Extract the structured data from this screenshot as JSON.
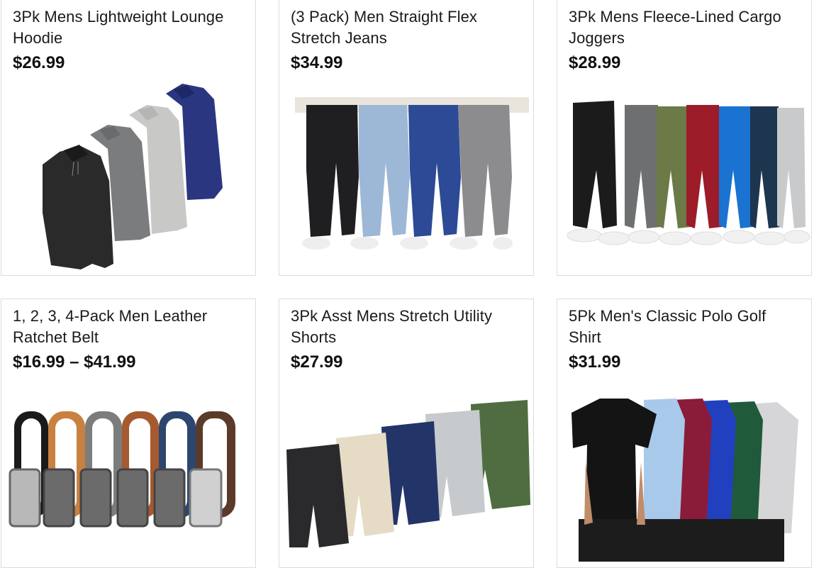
{
  "products": [
    {
      "title": "3Pk Mens Lightweight Lounge Hoodie",
      "price": "$26.99",
      "image": "hoodies-image"
    },
    {
      "title": "(3 Pack) Men Straight Flex Stretch Jeans",
      "price": "$34.99",
      "image": "jeans-image"
    },
    {
      "title": "3Pk Mens Fleece-Lined Cargo Joggers",
      "price": "$28.99",
      "image": "joggers-image"
    },
    {
      "title": "1, 2, 3, 4-Pack Men Leather Ratchet Belt",
      "price": "$16.99 – $41.99",
      "image": "belts-image"
    },
    {
      "title": "3Pk Asst Mens Stretch Utility Shorts",
      "price": "$27.99",
      "image": "shorts-image"
    },
    {
      "title": "5Pk Men's Classic Polo Golf Shirt",
      "price": "$31.99",
      "image": "polos-image"
    }
  ]
}
